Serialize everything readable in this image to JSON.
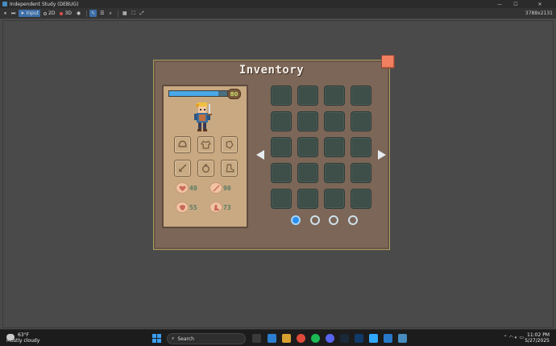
{
  "window": {
    "title": "Independent Study (DEBUG)",
    "minimize": "—",
    "maximize": "☐",
    "close": "✕"
  },
  "toolbar": {
    "pause": "⏸",
    "step": "⏭",
    "input_label": "Input",
    "btn_2d": "2D",
    "btn_3d": "3D",
    "resolution": "3788x2131"
  },
  "inventory": {
    "title": "Inventory",
    "hp_value": "80",
    "hp_fraction": 0.82,
    "stats": {
      "health": "40",
      "attack": "90",
      "defense": "55",
      "speed": "73"
    },
    "page_count": 4,
    "active_page": 1
  },
  "taskbar": {
    "temperature": "63°F",
    "weather": "Mostly cloudy",
    "search_placeholder": "Search",
    "time": "11:02 PM",
    "date": "5/27/2025"
  },
  "colors": {
    "panel": "#7b6657",
    "card": "#c8a982",
    "slot": "#3e4e49",
    "accent": "#2a8ff0",
    "close": "#f08060"
  }
}
